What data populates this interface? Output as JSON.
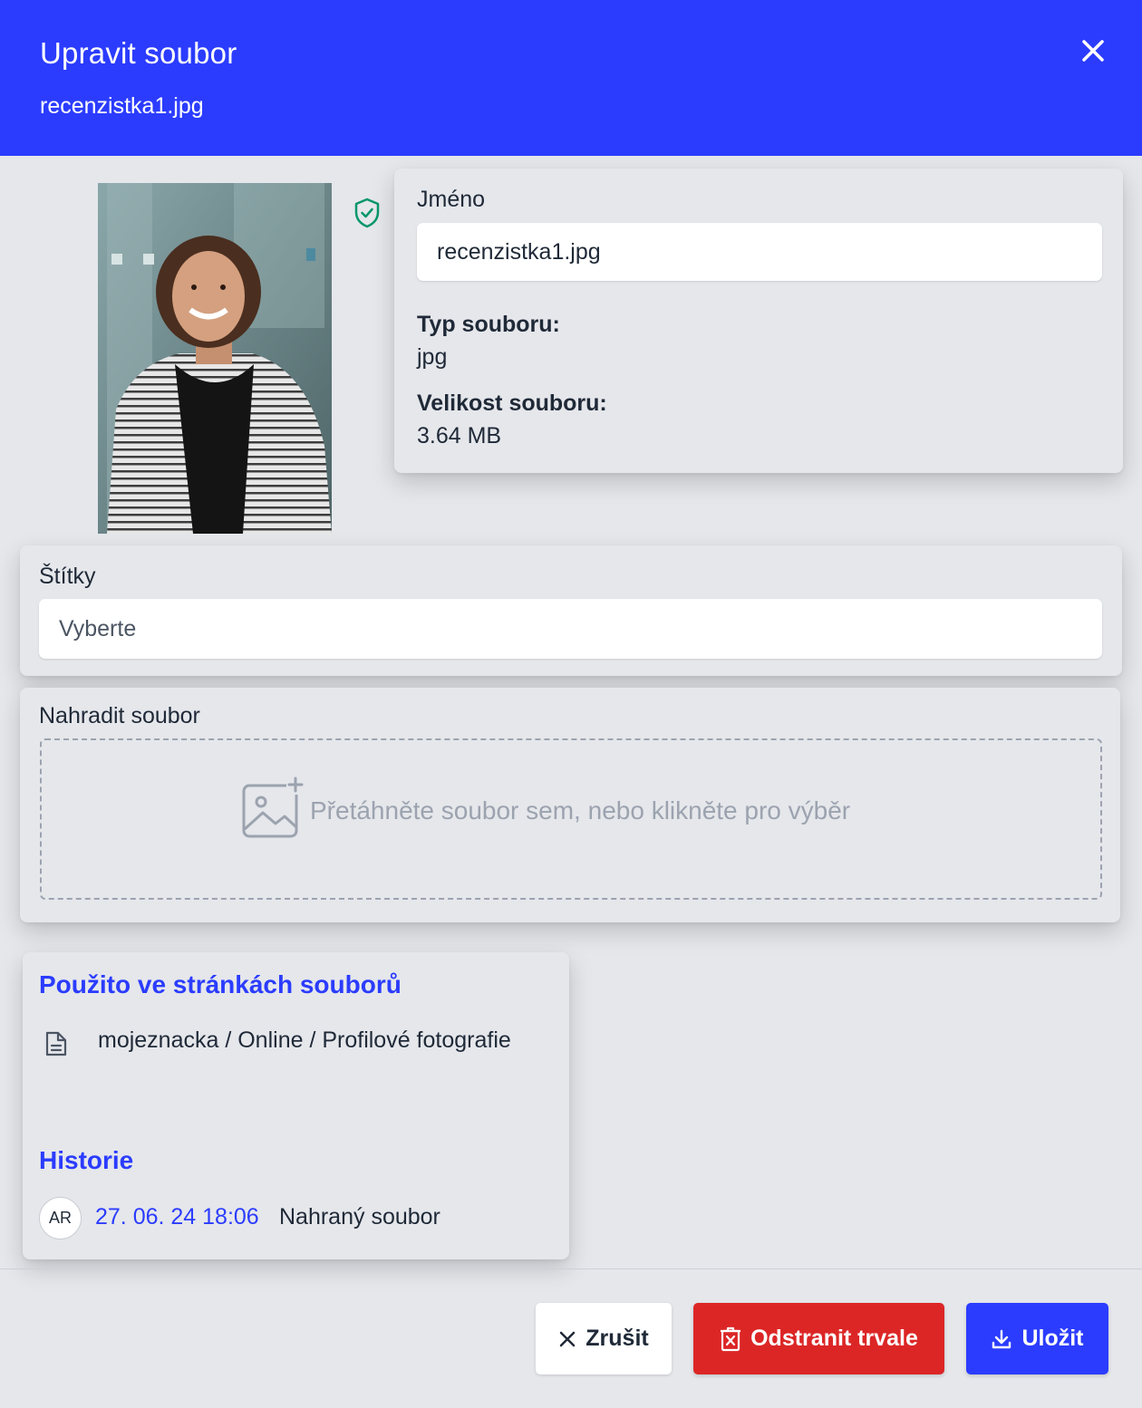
{
  "header": {
    "title": "Upravit soubor",
    "filename": "recenzistka1.jpg",
    "close_icon": "close-icon"
  },
  "preview": {
    "shield_icon": "shield-check-icon"
  },
  "info": {
    "name_label": "Jméno",
    "name_value": "recenzistka1.jpg",
    "type_label": "Typ souboru:",
    "type_value": "jpg",
    "size_label": "Velikost souboru:",
    "size_value": "3.64 MB"
  },
  "tags": {
    "label": "Štítky",
    "placeholder": "Vyberte"
  },
  "replace": {
    "label": "Nahradit soubor",
    "dropzone_text": "Přetáhněte soubor sem, nebo klikněte pro výběr",
    "icon": "image-add-icon"
  },
  "usage": {
    "title": "Použito ve stránkách souborů",
    "items": [
      {
        "icon": "document-icon",
        "path": "mojeznacka / Online / Profilové fotografie"
      }
    ]
  },
  "history": {
    "title": "Historie",
    "entries": [
      {
        "initials": "AR",
        "date": "27. 06. 24 18:06",
        "action": "Nahraný soubor"
      }
    ]
  },
  "footer": {
    "cancel_label": "Zrušit",
    "delete_label": "Odstranit trvale",
    "save_label": "Uložit"
  },
  "colors": {
    "primary": "#2b3cff",
    "danger": "#dc2626",
    "background": "#e5e7eb",
    "shield": "#059669"
  }
}
